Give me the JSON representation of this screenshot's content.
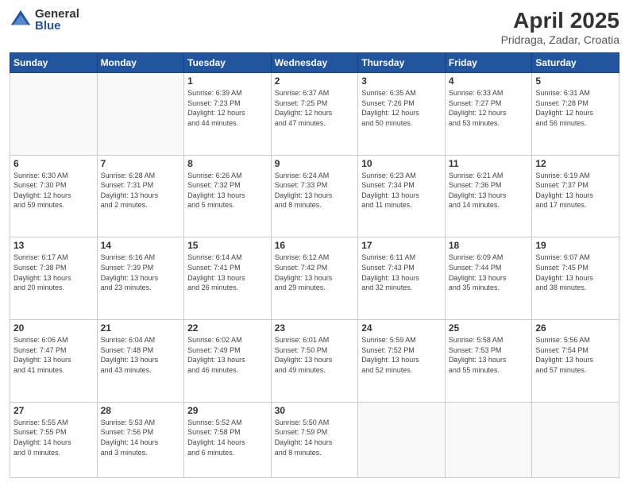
{
  "header": {
    "logo_general": "General",
    "logo_blue": "Blue",
    "month_year": "April 2025",
    "location": "Pridraga, Zadar, Croatia"
  },
  "weekdays": [
    "Sunday",
    "Monday",
    "Tuesday",
    "Wednesday",
    "Thursday",
    "Friday",
    "Saturday"
  ],
  "weeks": [
    [
      {
        "day": "",
        "info": ""
      },
      {
        "day": "",
        "info": ""
      },
      {
        "day": "1",
        "info": "Sunrise: 6:39 AM\nSunset: 7:23 PM\nDaylight: 12 hours\nand 44 minutes."
      },
      {
        "day": "2",
        "info": "Sunrise: 6:37 AM\nSunset: 7:25 PM\nDaylight: 12 hours\nand 47 minutes."
      },
      {
        "day": "3",
        "info": "Sunrise: 6:35 AM\nSunset: 7:26 PM\nDaylight: 12 hours\nand 50 minutes."
      },
      {
        "day": "4",
        "info": "Sunrise: 6:33 AM\nSunset: 7:27 PM\nDaylight: 12 hours\nand 53 minutes."
      },
      {
        "day": "5",
        "info": "Sunrise: 6:31 AM\nSunset: 7:28 PM\nDaylight: 12 hours\nand 56 minutes."
      }
    ],
    [
      {
        "day": "6",
        "info": "Sunrise: 6:30 AM\nSunset: 7:30 PM\nDaylight: 12 hours\nand 59 minutes."
      },
      {
        "day": "7",
        "info": "Sunrise: 6:28 AM\nSunset: 7:31 PM\nDaylight: 13 hours\nand 2 minutes."
      },
      {
        "day": "8",
        "info": "Sunrise: 6:26 AM\nSunset: 7:32 PM\nDaylight: 13 hours\nand 5 minutes."
      },
      {
        "day": "9",
        "info": "Sunrise: 6:24 AM\nSunset: 7:33 PM\nDaylight: 13 hours\nand 8 minutes."
      },
      {
        "day": "10",
        "info": "Sunrise: 6:23 AM\nSunset: 7:34 PM\nDaylight: 13 hours\nand 11 minutes."
      },
      {
        "day": "11",
        "info": "Sunrise: 6:21 AM\nSunset: 7:36 PM\nDaylight: 13 hours\nand 14 minutes."
      },
      {
        "day": "12",
        "info": "Sunrise: 6:19 AM\nSunset: 7:37 PM\nDaylight: 13 hours\nand 17 minutes."
      }
    ],
    [
      {
        "day": "13",
        "info": "Sunrise: 6:17 AM\nSunset: 7:38 PM\nDaylight: 13 hours\nand 20 minutes."
      },
      {
        "day": "14",
        "info": "Sunrise: 6:16 AM\nSunset: 7:39 PM\nDaylight: 13 hours\nand 23 minutes."
      },
      {
        "day": "15",
        "info": "Sunrise: 6:14 AM\nSunset: 7:41 PM\nDaylight: 13 hours\nand 26 minutes."
      },
      {
        "day": "16",
        "info": "Sunrise: 6:12 AM\nSunset: 7:42 PM\nDaylight: 13 hours\nand 29 minutes."
      },
      {
        "day": "17",
        "info": "Sunrise: 6:11 AM\nSunset: 7:43 PM\nDaylight: 13 hours\nand 32 minutes."
      },
      {
        "day": "18",
        "info": "Sunrise: 6:09 AM\nSunset: 7:44 PM\nDaylight: 13 hours\nand 35 minutes."
      },
      {
        "day": "19",
        "info": "Sunrise: 6:07 AM\nSunset: 7:45 PM\nDaylight: 13 hours\nand 38 minutes."
      }
    ],
    [
      {
        "day": "20",
        "info": "Sunrise: 6:06 AM\nSunset: 7:47 PM\nDaylight: 13 hours\nand 41 minutes."
      },
      {
        "day": "21",
        "info": "Sunrise: 6:04 AM\nSunset: 7:48 PM\nDaylight: 13 hours\nand 43 minutes."
      },
      {
        "day": "22",
        "info": "Sunrise: 6:02 AM\nSunset: 7:49 PM\nDaylight: 13 hours\nand 46 minutes."
      },
      {
        "day": "23",
        "info": "Sunrise: 6:01 AM\nSunset: 7:50 PM\nDaylight: 13 hours\nand 49 minutes."
      },
      {
        "day": "24",
        "info": "Sunrise: 5:59 AM\nSunset: 7:52 PM\nDaylight: 13 hours\nand 52 minutes."
      },
      {
        "day": "25",
        "info": "Sunrise: 5:58 AM\nSunset: 7:53 PM\nDaylight: 13 hours\nand 55 minutes."
      },
      {
        "day": "26",
        "info": "Sunrise: 5:56 AM\nSunset: 7:54 PM\nDaylight: 13 hours\nand 57 minutes."
      }
    ],
    [
      {
        "day": "27",
        "info": "Sunrise: 5:55 AM\nSunset: 7:55 PM\nDaylight: 14 hours\nand 0 minutes."
      },
      {
        "day": "28",
        "info": "Sunrise: 5:53 AM\nSunset: 7:56 PM\nDaylight: 14 hours\nand 3 minutes."
      },
      {
        "day": "29",
        "info": "Sunrise: 5:52 AM\nSunset: 7:58 PM\nDaylight: 14 hours\nand 6 minutes."
      },
      {
        "day": "30",
        "info": "Sunrise: 5:50 AM\nSunset: 7:59 PM\nDaylight: 14 hours\nand 8 minutes."
      },
      {
        "day": "",
        "info": ""
      },
      {
        "day": "",
        "info": ""
      },
      {
        "day": "",
        "info": ""
      }
    ]
  ]
}
